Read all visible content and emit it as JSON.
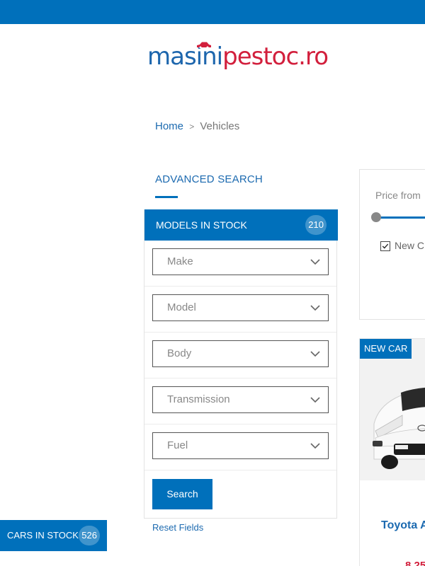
{
  "header": {
    "logo": {
      "part1": "masini",
      "part2": "pestoc.ro"
    }
  },
  "breadcrumb": {
    "home": "Home",
    "separator": ">",
    "current": "Vehicles"
  },
  "advanced_search": {
    "title": "ADVANCED SEARCH",
    "panel_title": "MODELS IN STOCK",
    "count": "210",
    "fields": [
      {
        "label": "Make"
      },
      {
        "label": "Model"
      },
      {
        "label": "Body"
      },
      {
        "label": "Transmission"
      },
      {
        "label": "Fuel"
      }
    ],
    "search_label": "Search",
    "reset_label": "Reset Fields"
  },
  "filter_panel": {
    "price_label": "Price from",
    "new_checkbox_label": "New C",
    "new_checked": true
  },
  "car_card": {
    "badge": "NEW CAR",
    "title": "Toyota A",
    "price": "8 25"
  },
  "floating_stock": {
    "label": "CARS IN STOCK",
    "count": "526"
  },
  "colors": {
    "primary": "#0070bb",
    "brand_red": "#d21f3c",
    "link_blue": "#1c6ab0"
  }
}
